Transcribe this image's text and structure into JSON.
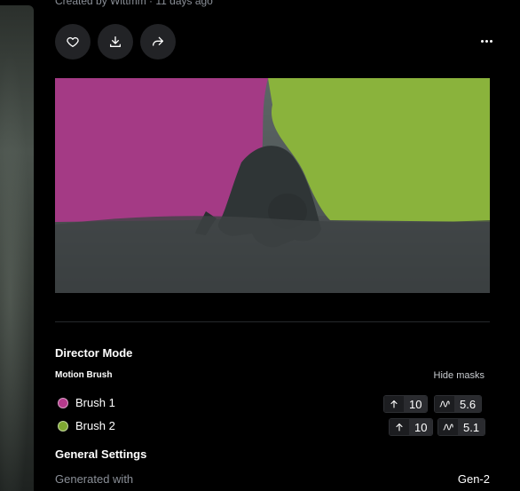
{
  "header": {
    "creator_line": "Created by Wittmm · 11 days ago"
  },
  "actions": {
    "like_icon": "heart-icon",
    "download_icon": "download-icon",
    "share_icon": "share-icon",
    "more_icon": "more-horizontal-icon"
  },
  "director": {
    "title": "Director Mode",
    "motion_brush_title": "Motion Brush",
    "hide_masks_label": "Hide masks",
    "brushes": [
      {
        "label": "Brush 1",
        "color": "#b53a8c",
        "up_value": "10",
        "wave_value": "5.6"
      },
      {
        "label": "Brush 2",
        "color": "#7fa832",
        "up_value": "10",
        "wave_value": "5.1"
      }
    ]
  },
  "general": {
    "title": "General Settings",
    "generated_with_label": "Generated with",
    "generated_with_value": "Gen-2"
  },
  "colors": {
    "mask_pink": "#a43a85",
    "mask_green": "#8ab33c",
    "muted_text": "#8a8f97"
  }
}
